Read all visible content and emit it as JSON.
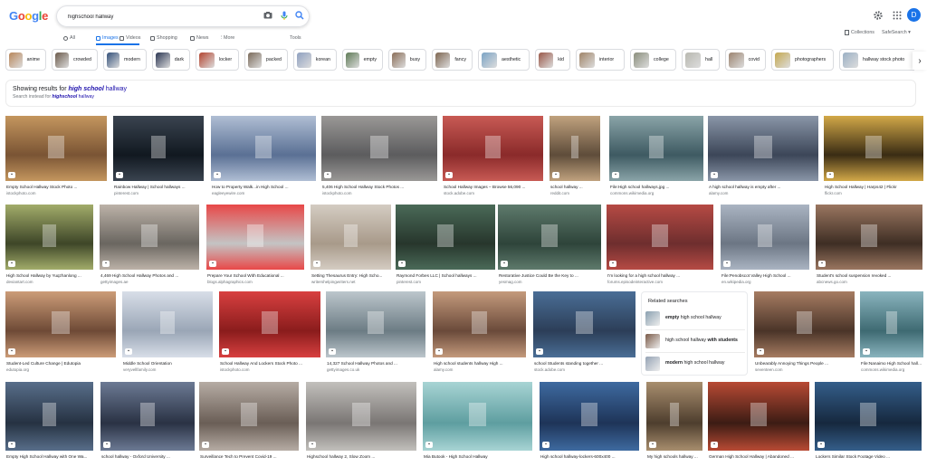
{
  "header": {
    "logo_letters": [
      {
        "ch": "G",
        "color": "#4285f4"
      },
      {
        "ch": "o",
        "color": "#ea4335"
      },
      {
        "ch": "o",
        "color": "#fbbc05"
      },
      {
        "ch": "g",
        "color": "#4285f4"
      },
      {
        "ch": "l",
        "color": "#34a853"
      },
      {
        "ch": "e",
        "color": "#ea4335"
      }
    ],
    "search_value": "highschool hallway",
    "avatar_letter": "D",
    "collections_label": "Collections",
    "safesearch_label": "SafeSearch ▾"
  },
  "tabs": [
    {
      "label": "All",
      "icon": "search-icon"
    },
    {
      "label": "Images",
      "icon": "image-icon",
      "active": true
    },
    {
      "label": "Videos",
      "icon": "video-icon"
    },
    {
      "label": "Shopping",
      "icon": "tag-icon"
    },
    {
      "label": "News",
      "icon": "news-icon"
    },
    {
      "label": "More",
      "icon": "more-vert-icon"
    }
  ],
  "tools_label": "Tools",
  "chips": [
    {
      "label": "anime",
      "color": "#b8865a"
    },
    {
      "label": "crowded",
      "color": "#6b5a4a"
    },
    {
      "label": "modern",
      "color": "#33507a"
    },
    {
      "label": "dark",
      "color": "#2a3552"
    },
    {
      "label": "locker",
      "color": "#b3442f"
    },
    {
      "label": "packed",
      "color": "#7a6a5a"
    },
    {
      "label": "korean",
      "color": "#8ea0c0"
    },
    {
      "label": "empty",
      "color": "#5e7a56"
    },
    {
      "label": "busy",
      "color": "#8a6e58"
    },
    {
      "label": "fancy",
      "color": "#7d6550"
    },
    {
      "label": "aesthetic",
      "color": "#7aa3c4"
    },
    {
      "label": "kid",
      "color": "#9a5848"
    },
    {
      "label": "interior",
      "color": "#a08468"
    },
    {
      "label": "college",
      "color": "#8a8e7c"
    },
    {
      "label": "hall",
      "color": "#b8b8b0"
    },
    {
      "label": "covid",
      "color": "#9c8470"
    },
    {
      "label": "photographers",
      "color": "#c4a84e"
    },
    {
      "label": "hallway stock photo",
      "color": "#9ab0c4"
    },
    {
      "label": "stock",
      "color": "#7a7060"
    }
  ],
  "notice": {
    "prefix": "Showing results for ",
    "corrected_bold": "high school",
    "corrected_rest": " hallway",
    "instead_prefix": "Search instead for ",
    "instead_query": "highschool",
    "instead_rest": " hallway"
  },
  "related": {
    "title": "Related searches",
    "items": [
      {
        "bold_pre": "empty",
        "text": " high school hallway",
        "bold_post": "",
        "color": "#8aa0b0"
      },
      {
        "bold_pre": "",
        "text": "high school hallway ",
        "bold_post": "with students",
        "color": "#7a5a48"
      },
      {
        "bold_pre": "modern",
        "text": " high school hallway",
        "bold_post": "",
        "color": "#94a2b4"
      }
    ]
  },
  "results": [
    {
      "caption": "Empty School Hallway Stock Photo ...",
      "source": "istockphoto.com",
      "colors": [
        "#c4965e",
        "#7a5434"
      ]
    },
    {
      "caption": "Rainbow Hallway | School hallways ...",
      "source": "pinterest.com",
      "colors": [
        "#3a4450",
        "#111820"
      ]
    },
    {
      "caption": "How to Property Walk...in High School ...",
      "source": "eagleeyewire.com",
      "colors": [
        "#b0bed4",
        "#5a7094"
      ]
    },
    {
      "caption": "5,406 High School Hallway Stock Photos ...",
      "source": "istockphoto.com",
      "colors": [
        "#9a9896",
        "#5c5c5e"
      ]
    },
    {
      "caption": "School Hallway Images – Browse 56,090 ...",
      "source": "stock.adobe.com",
      "colors": [
        "#c85a54",
        "#8a2a2a"
      ]
    },
    {
      "caption": "school hallway ...",
      "source": "reddit.com",
      "colors": [
        "#c0a27e",
        "#5e4c3a"
      ]
    },
    {
      "caption": "File:High school hallways.jpg ...",
      "source": "commons.wikimedia.org",
      "colors": [
        "#8aa4a8",
        "#3e5a62"
      ]
    },
    {
      "caption": "A high school hallway is empty after ...",
      "source": "alamy.com",
      "colors": [
        "#8a96a8",
        "#3c4658"
      ]
    },
    {
      "caption": "High School Hallway | Harps42 | Flickr",
      "source": "flickr.com",
      "colors": [
        "#d2a848",
        "#3a2c14"
      ]
    },
    {
      "caption": "High School Hallway by Yuqzhanlong ...",
      "source": "deviantart.com",
      "colors": [
        "#a2ac6a",
        "#3e4628"
      ]
    },
    {
      "caption": "4,469 High School Hallway Photos and ...",
      "source": "gettyimages.ae",
      "colors": [
        "#bcb2a8",
        "#6a6660"
      ]
    },
    {
      "caption": "Prepare Your School With Educational ...",
      "source": "blogs.alphagraphics.com",
      "colors": [
        "#e84848",
        "#c4c4c4"
      ]
    },
    {
      "caption": "Setting Thesaurus Entry: High Scho...",
      "source": "writershelpingwriters.net",
      "colors": [
        "#d4ccc2",
        "#a89a8a"
      ]
    },
    {
      "caption": "Raymond Forbes LLC | School hallways ...",
      "source": "pinterest.com",
      "colors": [
        "#4a6a58",
        "#27362c"
      ]
    },
    {
      "caption": "Restorative Justice Could Be the Key to ...",
      "source": "yesmag.com",
      "colors": [
        "#5e7a6c",
        "#2e443a"
      ]
    },
    {
      "caption": "I'm looking for a high school hallway ...",
      "source": "forums.episodeinteractive.com",
      "colors": [
        "#b64a44",
        "#6e2e2e"
      ]
    },
    {
      "caption": "File:Penobscot Valley High School ...",
      "source": "en.wikipedia.org",
      "colors": [
        "#aab4c2",
        "#6c7684"
      ]
    },
    {
      "caption": "Student's school suspension revoked ...",
      "source": "abcnews.go.com",
      "colors": [
        "#9a7660",
        "#3e2e24"
      ]
    },
    {
      "caption": "Student-Led Culture Change | Edutopia",
      "source": "edutopia.org",
      "colors": [
        "#cc9c78",
        "#6e4a36"
      ]
    },
    {
      "caption": "Middle School Orientation",
      "source": "veryvellfamily.com",
      "colors": [
        "#d8dee8",
        "#9aa6b6"
      ]
    },
    {
      "caption": "School Hallway And Lockers Stock Photo ...",
      "source": "istockphoto.com",
      "colors": [
        "#d84040",
        "#8a1c1c"
      ]
    },
    {
      "caption": "14,327 School Hallway Photos and ...",
      "source": "gettyimages.co.uk",
      "colors": [
        "#bcc6cc",
        "#6c7c84"
      ]
    },
    {
      "caption": "High school students hallway High ...",
      "source": "alamy.com",
      "colors": [
        "#c49a7c",
        "#6a4a3a"
      ]
    },
    {
      "caption": "school Students standing together ...",
      "source": "stock.adobe.com",
      "colors": [
        "#4a6e96",
        "#2c3e58"
      ]
    },
    {
      "caption": "Unbearably Annoying Things People ...",
      "source": "seventeen.com",
      "colors": [
        "#a67c62",
        "#4a3428"
      ]
    },
    {
      "caption": "File:Nanaimo High School hallway.jpg ...",
      "source": "commons.wikimedia.org",
      "colors": [
        "#8ab4be",
        "#3e6a72"
      ]
    },
    {
      "caption": "Empty High School Hallway with One Wa...",
      "source": "",
      "colors": [
        "#586e8a",
        "#263242"
      ]
    },
    {
      "caption": "school hallway - Oxford University ...",
      "source": "",
      "colors": [
        "#6c7a94",
        "#2a3244"
      ]
    },
    {
      "caption": "Surveillance Tech to Prevent Covid-19 ...",
      "source": "",
      "colors": [
        "#b6aca4",
        "#6a5e56"
      ]
    },
    {
      "caption": "Highschool hallway 2, Slow Zoom ...",
      "source": "",
      "colors": [
        "#c2c0bc",
        "#7a7674"
      ]
    },
    {
      "caption": "Mia Butook - High School Hallway",
      "source": "",
      "colors": [
        "#a8d4d4",
        "#5e9ea0"
      ]
    },
    {
      "caption": "High school hallway-lockers-600x400 ...",
      "source": "",
      "colors": [
        "#3e6aa0",
        "#1e3458"
      ]
    },
    {
      "caption": "My high schools hallway ...",
      "source": "",
      "colors": [
        "#a88e6e",
        "#4e3e2e"
      ]
    },
    {
      "caption": "German High School Hallway | Abandoned ...",
      "source": "",
      "colors": [
        "#b84a34",
        "#3c1c14"
      ]
    },
    {
      "caption": "Lockers Similar Stock Footage Video ...",
      "source": "",
      "colors": [
        "#345e8a",
        "#16283e"
      ]
    }
  ]
}
